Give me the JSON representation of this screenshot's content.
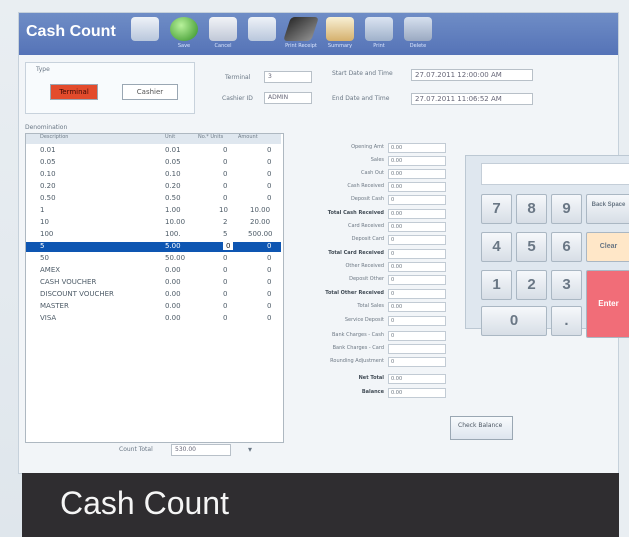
{
  "app": {
    "title": "Cash Count",
    "footer_title": "Cash Count"
  },
  "toolbar": [
    {
      "label": "",
      "icon": "blank-document-icon"
    },
    {
      "label": "Save",
      "icon": "check-save-icon"
    },
    {
      "label": "Cancel",
      "icon": "cancel-document-icon"
    },
    {
      "label": "",
      "icon": "blank-document-icon"
    },
    {
      "label": "Print Receipt",
      "icon": "print-card-icon"
    },
    {
      "label": "Summary",
      "icon": "calendar-icon"
    },
    {
      "label": "Print",
      "icon": "printer-icon"
    },
    {
      "label": "Delete",
      "icon": "trash-icon"
    }
  ],
  "type": {
    "label": "Type",
    "terminal": "Terminal",
    "cashier": "Cashier"
  },
  "details": {
    "terminal_label": "Terminal",
    "terminal_value": "3",
    "cashier_label": "Cashier ID",
    "cashier_value": "ADMIN",
    "start_label": "Start Date and Time",
    "start_value": "27.07.2011 12:00:00 AM",
    "end_label": "End Date and Time",
    "end_value": "27.07.2011 11:06:52 AM"
  },
  "denominations": {
    "section_label": "Denomination",
    "headers": [
      "Description",
      "Unit",
      "No.* Units",
      "Amount"
    ],
    "rows": [
      {
        "desc": "0.01",
        "unit": "0.01",
        "count": "0",
        "amount": "0"
      },
      {
        "desc": "0.05",
        "unit": "0.05",
        "count": "0",
        "amount": "0"
      },
      {
        "desc": "0.10",
        "unit": "0.10",
        "count": "0",
        "amount": "0"
      },
      {
        "desc": "0.20",
        "unit": "0.20",
        "count": "0",
        "amount": "0"
      },
      {
        "desc": "0.50",
        "unit": "0.50",
        "count": "0",
        "amount": "0"
      },
      {
        "desc": "1",
        "unit": "1.00",
        "count": "10",
        "amount": "10.00"
      },
      {
        "desc": "10",
        "unit": "10.00",
        "count": "2",
        "amount": "20.00"
      },
      {
        "desc": "100",
        "unit": "100.",
        "count": "5",
        "amount": "500.00"
      },
      {
        "desc": "5",
        "unit": "5.00",
        "count": "0",
        "amount": "0"
      },
      {
        "desc": "50",
        "unit": "50.00",
        "count": "0",
        "amount": "0"
      },
      {
        "desc": "AMEX",
        "unit": "0.00",
        "count": "0",
        "amount": "0"
      },
      {
        "desc": "CASH VOUCHER",
        "unit": "0.00",
        "count": "0",
        "amount": "0"
      },
      {
        "desc": "DISCOUNT VOUCHER",
        "unit": "0.00",
        "count": "0",
        "amount": "0"
      },
      {
        "desc": "MASTER",
        "unit": "0.00",
        "count": "0",
        "amount": "0"
      },
      {
        "desc": "VISA",
        "unit": "0.00",
        "count": "0",
        "amount": "0"
      }
    ],
    "count_total_label": "Count Total",
    "count_total_value": "530.00"
  },
  "summary": [
    {
      "label": "Opening Amt",
      "value": "0.00"
    },
    {
      "label": "Sales",
      "value": "0.00"
    },
    {
      "label": "Cash Out",
      "value": "0.00"
    },
    {
      "label": "Cash Received",
      "value": "0.00"
    },
    {
      "label": "Deposit Cash",
      "value": "0"
    },
    {
      "label": "Total Cash Received",
      "value": "0.00"
    },
    {
      "label": "Card Received",
      "value": "0.00"
    },
    {
      "label": "Deposit Card",
      "value": "0"
    },
    {
      "label": "Total Card Received",
      "value": "0"
    },
    {
      "label": "Other Received",
      "value": "0.00"
    },
    {
      "label": "Deposit Other",
      "value": "0"
    },
    {
      "label": "Total Other Received",
      "value": "0"
    },
    {
      "label": "Total Sales",
      "value": "0.00"
    },
    {
      "label": "Service Deposit",
      "value": "0"
    },
    {
      "label": "Bank Charges - Cash",
      "value": "0"
    },
    {
      "label": "Bank Charges - Card",
      "value": ""
    },
    {
      "label": "Rounding Adjustment",
      "value": "0"
    },
    {
      "label": "Net Total",
      "value": "0.00"
    },
    {
      "label": "Balance",
      "value": "0.00"
    }
  ],
  "check_balance": "Check Balance",
  "keypad": {
    "display_value": "",
    "keys": [
      "7",
      "8",
      "9",
      "4",
      "5",
      "6",
      "1",
      "2",
      "3",
      "0",
      "."
    ],
    "back_space": "Back Space",
    "clear": "Clear",
    "enter": "Enter"
  },
  "colors": {
    "accent": "#5573b7",
    "selected_row": "#0e56b2",
    "terminal_button": "#e34b2c",
    "clear_key": "#ffe7c8",
    "enter_key": "#f16d78"
  }
}
